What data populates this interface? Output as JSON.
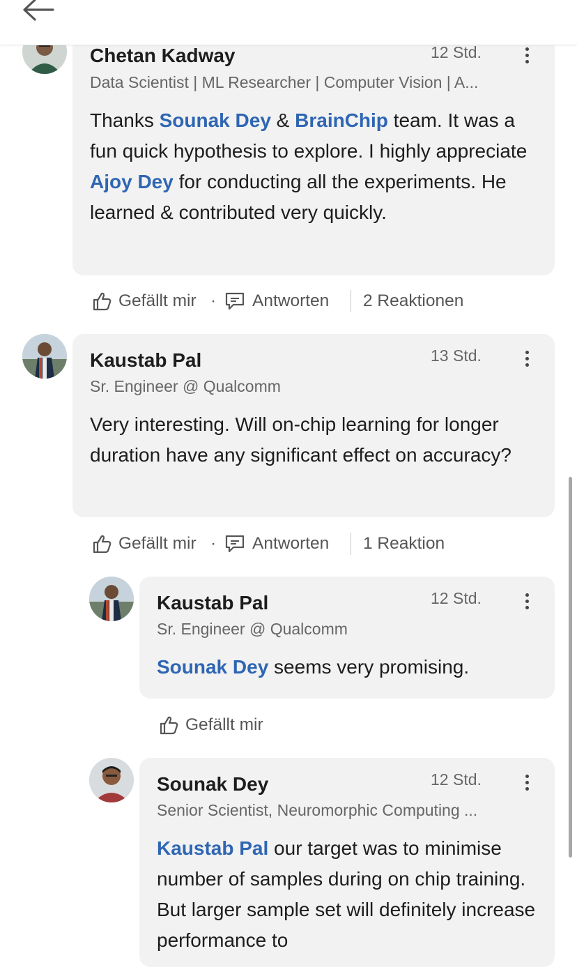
{
  "header": {
    "back_icon": "arrow-left-icon"
  },
  "colors": {
    "mention": "#2f66b3",
    "bubble": "#f2f2f2",
    "secondary_text": "#666666"
  },
  "comments": [
    {
      "author": "Chetan Kadway",
      "headline": "Data Scientist | ML Researcher | Computer Vision | A...",
      "time": "12 Std.",
      "body": {
        "p1": "Thanks ",
        "m1": "Sounak Dey",
        "p2": " & ",
        "m2": "BrainChip",
        "p3": " team. It was a fun quick hypothesis to explore. I highly appreciate ",
        "m3": "Ajoy Dey",
        "p4": " for conducting all the experiments. He learned & contributed very quickly."
      },
      "like_label": "Gefällt mir",
      "reply_label": "Antworten",
      "reactions": "2 Reaktionen"
    },
    {
      "author": "Kaustab Pal",
      "headline": "Sr. Engineer @ Qualcomm",
      "time": "13 Std.",
      "body": {
        "p1": "Very interesting. Will on-chip learning for longer duration have any significant effect on accuracy?"
      },
      "like_label": "Gefällt mir",
      "reply_label": "Antworten",
      "reactions": "1 Reaktion"
    }
  ],
  "replies": [
    {
      "author": "Kaustab Pal",
      "headline": "Sr. Engineer @ Qualcomm",
      "time": "12 Std.",
      "body": {
        "m1": "Sounak Dey",
        "p1": " seems very promising."
      },
      "like_label": "Gefällt mir"
    },
    {
      "author": "Sounak Dey",
      "headline": "Senior Scientist, Neuromorphic Computing ...",
      "time": "12 Std.",
      "body": {
        "m1": "Kaustab Pal",
        "p1": " our target was to minimise number of samples during on chip training. But larger sample set will definitely increase performance to"
      }
    }
  ]
}
